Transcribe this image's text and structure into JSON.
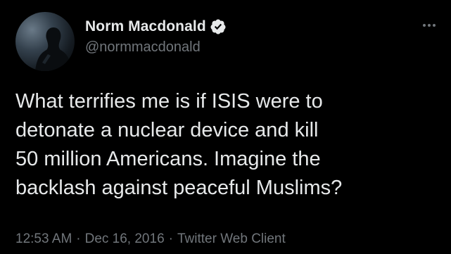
{
  "author": {
    "display_name": "Norm Macdonald",
    "handle": "@normmacdonald",
    "verified": true,
    "avatar_icon": "profile-photo-silhouette"
  },
  "tweet": {
    "text": "What terrifies me is if ISIS were to\ndetonate a nuclear device and kill\n50 million Americans. Imagine the\nbacklash against peaceful Muslims?"
  },
  "meta": {
    "time": "12:53 AM",
    "date": "Dec 16, 2016",
    "source": "Twitter Web Client",
    "separator": "·"
  },
  "icons": {
    "verified": "verified-badge-icon",
    "more": "more-options-icon"
  },
  "colors": {
    "background": "#000000",
    "text_primary": "#e7e9ea",
    "text_secondary": "#71767b",
    "verified_badge": "#e7e9ea"
  }
}
